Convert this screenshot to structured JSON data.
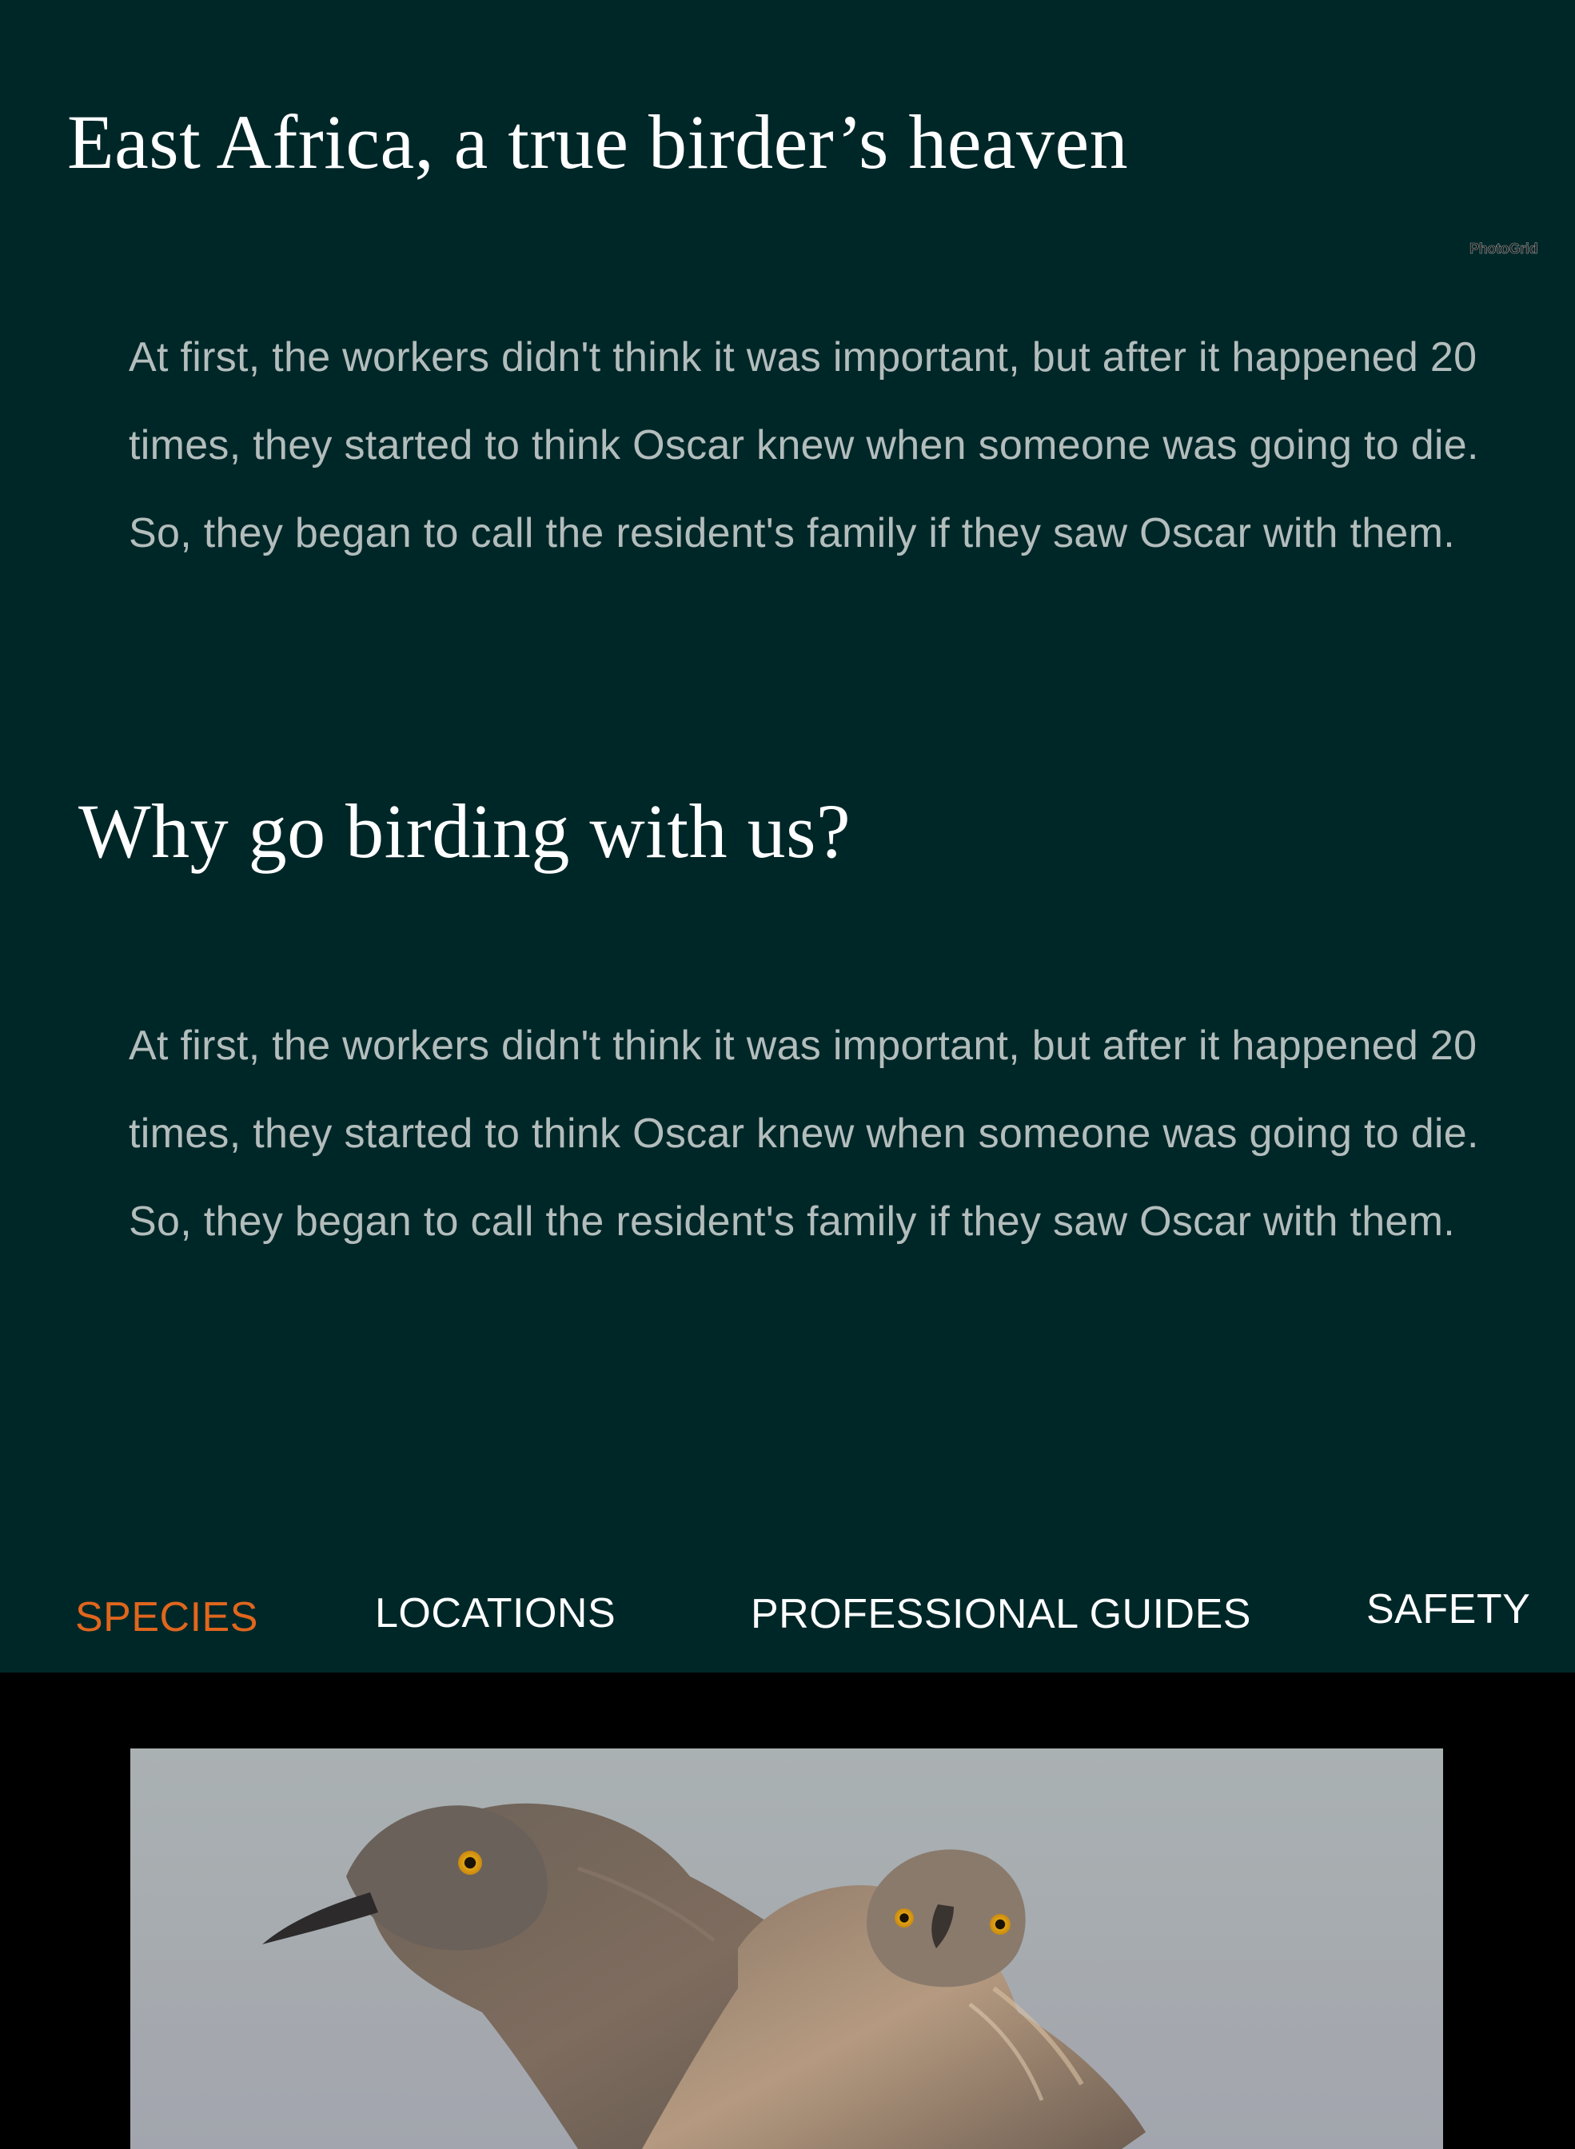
{
  "sections": [
    {
      "title": "East Africa, a true birder’s heaven",
      "body": "At first, the workers didn't think it was important, but after it happened 20 times, they started to think Oscar knew when someone was going to die. So, they began to call the resident's family if they saw Oscar with them."
    },
    {
      "title": "Why go birding with us?",
      "body": "At first, the workers didn't think it was important, but after it happened 20 times, they started to think Oscar knew when someone was going to die. So, they began to call the resident's family if they saw Oscar with them."
    }
  ],
  "watermark": "PhotoGrid",
  "tabs": [
    {
      "label": "SPECIES",
      "active": true
    },
    {
      "label": "LOCATIONS",
      "active": false
    },
    {
      "label": "PROFESSIONAL GUIDES",
      "active": false
    },
    {
      "label": "SAFETY",
      "active": false
    }
  ],
  "colors": {
    "background": "#002728",
    "active_tab": "#e0661d",
    "tab": "#ffffff",
    "body_text": "#b3bdbc"
  },
  "photo": {
    "subject": "two-birds-photo"
  }
}
